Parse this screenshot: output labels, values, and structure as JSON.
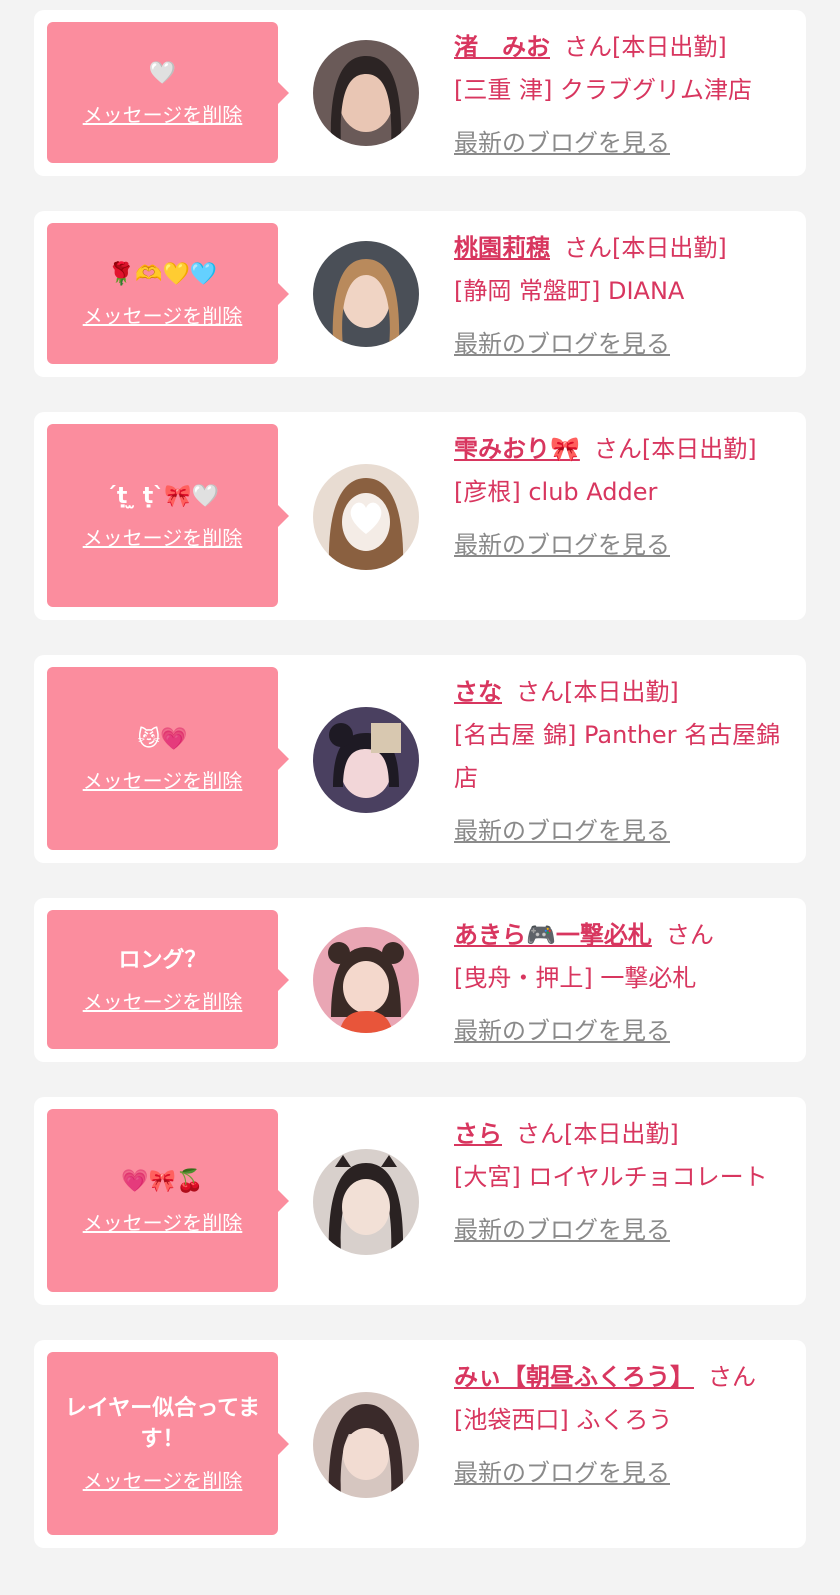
{
  "entries": [
    {
      "message": "🤍",
      "delete_label": "メッセージを削除",
      "name": "渚　みお",
      "suffix": "さん[本日出勤]",
      "shop": "[三重 津] クラブグリム津店",
      "blog_label": "最新のブログを見る",
      "avatar_colors": [
        "#6a5a58",
        "#e9c6b4",
        "#2c2424"
      ]
    },
    {
      "message": "🌹🫶💛🩵",
      "delete_label": "メッセージを削除",
      "name": "桃園莉穂",
      "suffix": "さん[本日出勤]",
      "shop": "[静岡 常盤町] DIANA",
      "blog_label": "最新のブログを見る",
      "avatar_colors": [
        "#4a4f57",
        "#f0d4c4",
        "#b98a5c"
      ]
    },
    {
      "message": "´ṭ ̫ ṭ`🎀🤍",
      "delete_label": "メッセージを削除",
      "name": "雫みおり🎀",
      "suffix": "さん[本日出勤]",
      "shop": "[彦根] club Adder",
      "blog_label": "最新のブログを見る",
      "avatar_colors": [
        "#e8dcd2",
        "#f4ece6",
        "#8a6040"
      ]
    },
    {
      "message": "😼💗",
      "delete_label": "メッセージを削除",
      "name": "さな",
      "suffix": "さん[本日出勤]",
      "shop": "[名古屋 錦] Panther 名古屋錦店",
      "blog_label": "最新のブログを見る",
      "avatar_colors": [
        "#4a4060",
        "#f2d6d8",
        "#1e1a24"
      ]
    },
    {
      "message": "ロング？",
      "delete_label": "メッセージを削除",
      "name": "あきら🎮一撃必札",
      "suffix": "さん",
      "shop": "[曳舟・押上] 一撃必札",
      "blog_label": "最新のブログを見る",
      "avatar_colors": [
        "#e9a6b4",
        "#f4d8cc",
        "#3a2a26"
      ]
    },
    {
      "message": "💗🎀🍒",
      "delete_label": "メッセージを削除",
      "name": "さら",
      "suffix": "さん[本日出勤]",
      "shop": "[大宮] ロイヤルチョコレート",
      "blog_label": "最新のブログを見る",
      "avatar_colors": [
        "#d8d0cc",
        "#f2e0d6",
        "#2a2222"
      ]
    },
    {
      "message": "レイヤー似合ってます！",
      "delete_label": "メッセージを削除",
      "name": "みぃ【朝昼ふくろう】",
      "suffix": "さん",
      "shop": "[池袋西口] ふくろう",
      "blog_label": "最新のブログを見る",
      "avatar_colors": [
        "#d6c6c0",
        "#f2dcd2",
        "#3a2a2a"
      ]
    }
  ]
}
